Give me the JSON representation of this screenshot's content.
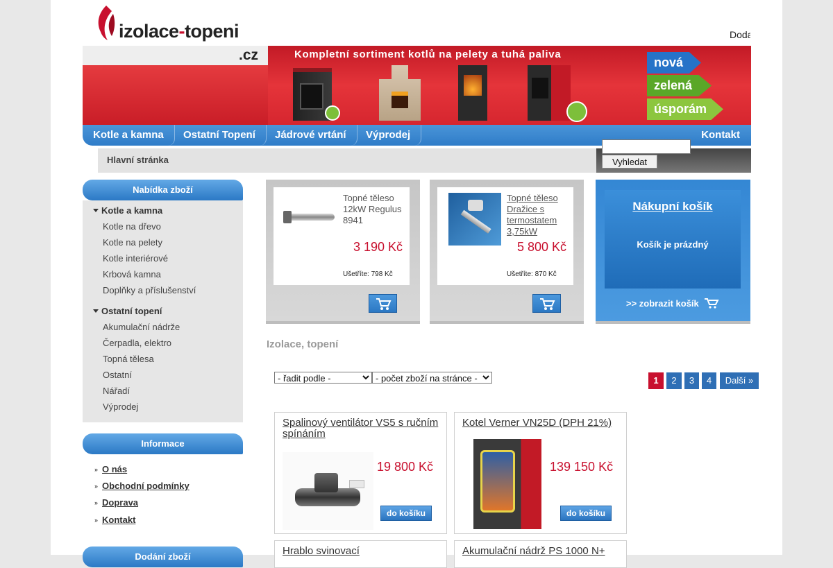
{
  "header": {
    "logo_main": "izolace",
    "logo_hyphen": "-",
    "logo_second": "topeni",
    "logo_tld": ".cz",
    "top_promo": "Doda",
    "banner_title": "Kompletní sortiment kotlů na pelety a tuhá paliva",
    "tags": [
      "nová",
      "zelená",
      "úsporám"
    ]
  },
  "nav": {
    "items": [
      "Kotle a kamna",
      "Ostatní Topení",
      "Jádrové vrtání",
      "Výprodej"
    ],
    "contact": "Kontakt"
  },
  "breadcrumb": "Hlavní stránka",
  "search": {
    "button": "Vyhledat",
    "value": ""
  },
  "sidebar": {
    "catalog_title": "Nabídka zboží",
    "groups": [
      {
        "label": "Kotle a kamna",
        "items": [
          "Kotle na dřevo",
          "Kotle na pelety",
          "Kotle interiérové",
          "Krbová kamna",
          "Doplňky a příslušenství"
        ]
      },
      {
        "label": "Ostatní topení",
        "items": [
          "Akumulační nádrže",
          "Čerpadla, elektro",
          "Topná tělesa",
          "Ostatní",
          "Nářadí",
          "Výprodej"
        ]
      }
    ],
    "info_title": "Informace",
    "info_items": [
      "O nás",
      "Obchodní podmínky",
      "Doprava",
      "Kontakt"
    ],
    "third_title": "Dodání zboží"
  },
  "top_products": [
    {
      "title": "Topné těleso 12kW Regulus 8941",
      "price": "3 190 Kč",
      "save": "Ušetříte: 798 Kč"
    },
    {
      "title": "Topné těleso Dražice s termostatem 3,75kW",
      "price": "5 800 Kč",
      "save": "Ušetříte: 870 Kč"
    }
  ],
  "cart": {
    "title": "Nákupní košík",
    "empty": "Košík je prázdný",
    "link": ">> zobrazit košík"
  },
  "section_title": "Izolace, topení",
  "sort": {
    "order": "- řadit podle -",
    "per_page": "- počet zboží na stránce -"
  },
  "pagination": {
    "pages": [
      "1",
      "2",
      "3",
      "4"
    ],
    "next": "Další »",
    "current": "1"
  },
  "products": [
    {
      "name": "Spalinový ventilátor VS5 s ručním spínáním",
      "price": "19 800 Kč",
      "button": "do košíku"
    },
    {
      "name": "Kotel Verner VN25D (DPH 21%)",
      "price": "139 150 Kč",
      "button": "do košíku"
    },
    {
      "name": "Hrablo svinovací",
      "price": "",
      "button": ""
    },
    {
      "name": "Akumulační nádrž PS 1000 N+",
      "price": "",
      "button": ""
    }
  ],
  "colors": {
    "brand_red": "#c8102e",
    "nav_blue": "#2f7cc8",
    "sidebar_bg": "#e6e6e6"
  }
}
